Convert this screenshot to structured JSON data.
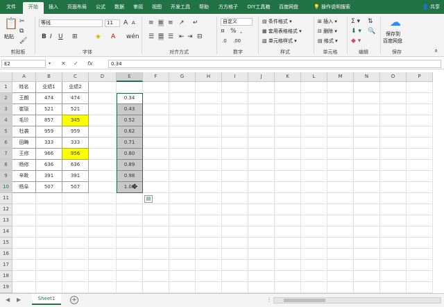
{
  "tabs": [
    "文件",
    "开始",
    "插入",
    "页面布局",
    "公式",
    "数据",
    "审阅",
    "视图",
    "开发工具",
    "帮助",
    "方方格子",
    "DIY工具箱",
    "百度网盘"
  ],
  "active_tab": 1,
  "tell_me": "操作说明搜索",
  "share": "共享",
  "ribbon": {
    "paste": "粘贴",
    "font_name": "等线",
    "font_size": "11",
    "number_format": "自定义",
    "cond_format": "条件格式",
    "table_format": "套用表格格式",
    "cell_style": "单元格样式",
    "insert": "插入",
    "delete": "删除",
    "format": "格式",
    "save_to": "保存到",
    "baidu": "百度网盘",
    "groups": [
      "剪贴板",
      "字体",
      "对齐方式",
      "数字",
      "样式",
      "单元格",
      "编辑",
      "保存"
    ]
  },
  "formula_bar": {
    "name_box": "E2",
    "fx": "fx",
    "value": "0.34"
  },
  "columns": [
    "A",
    "B",
    "C",
    "D",
    "E",
    "F",
    "G",
    "H",
    "I",
    "J",
    "K",
    "L",
    "M",
    "N",
    "O",
    "P"
  ],
  "rows": [
    "1",
    "2",
    "3",
    "4",
    "5",
    "6",
    "7",
    "8",
    "9",
    "10",
    "11",
    "12",
    "13",
    "14",
    "15",
    "16",
    "17",
    "18",
    "19"
  ],
  "table": {
    "header": [
      "姓名",
      "业绩1",
      "业绩2"
    ],
    "rows": [
      [
        "王朗",
        "474",
        "474"
      ],
      [
        "崔琰",
        "521",
        "521"
      ],
      [
        "毛玠",
        "857",
        "345"
      ],
      [
        "杜袭",
        "959",
        "959"
      ],
      [
        "田畴",
        "333",
        "333"
      ],
      [
        "王修",
        "966",
        "956"
      ],
      [
        "杨修",
        "636",
        "636"
      ],
      [
        "辛毗",
        "391",
        "391"
      ],
      [
        "杨阜",
        "507",
        "507"
      ]
    ]
  },
  "col_e": [
    "0.34",
    "0.43",
    "0.52",
    "0.62",
    "0.71",
    "0.80",
    "0.89",
    "0.98",
    "1.08"
  ],
  "sheet_name": "Sheet1",
  "colors": {
    "brand": "#217346",
    "highlight": "#ffff00",
    "selected_fill": "#c9c9c9"
  }
}
